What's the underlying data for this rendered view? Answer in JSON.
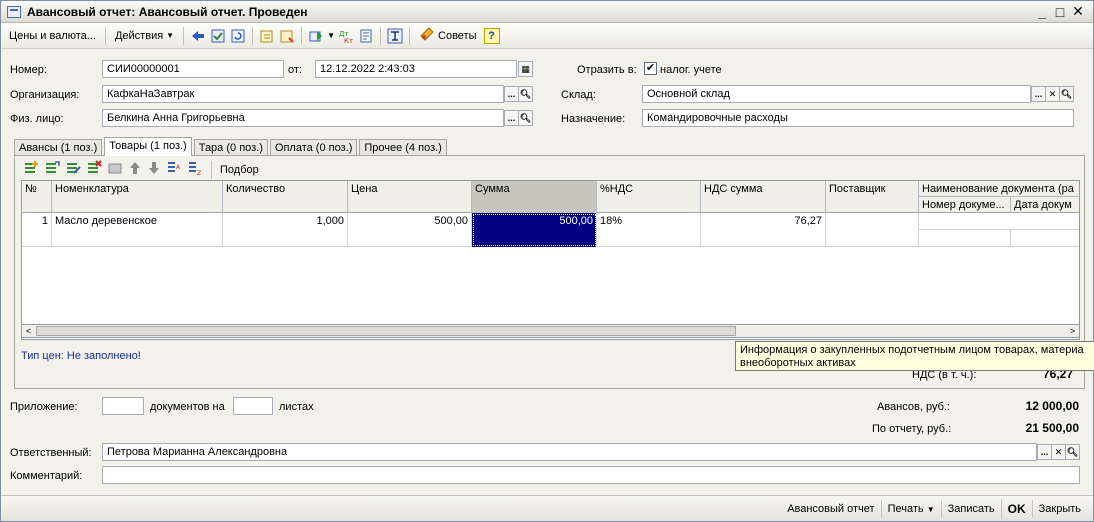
{
  "window": {
    "title": "Авансовый отчет: Авансовый отчет. Проведен",
    "min": "_",
    "max": "□",
    "close": "✕"
  },
  "toolbar": {
    "prices_currency": "Цены и валюта...",
    "actions": "Действия",
    "tips": "Советы",
    "help": "?"
  },
  "form": {
    "number_label": "Номер:",
    "number_value": "СИИ00000001",
    "from_label": "от:",
    "date_value": "12.12.2022  2:43:03",
    "reflect_label": "Отразить в:",
    "tax_accounting_label": "налог. учете",
    "tax_accounting_checked": "✔",
    "org_label": "Организация:",
    "org_value": "КафкаНаЗавтрак",
    "warehouse_label": "Склад:",
    "warehouse_value": "Основной склад",
    "person_label": "Физ. лицо:",
    "person_value": "Белкина Анна Григорьевна",
    "purpose_label": "Назначение:",
    "purpose_value": "Командировочные расходы"
  },
  "tabs": [
    {
      "label": "Авансы (1 поз.)"
    },
    {
      "label": "Товары (1 поз.)"
    },
    {
      "label": "Тара (0 поз.)"
    },
    {
      "label": "Оплата (0 поз.)"
    },
    {
      "label": "Прочее (4 поз.)"
    }
  ],
  "table_toolbar": {
    "selection": "Подбор"
  },
  "table": {
    "headers": {
      "num": "№",
      "nomenclature": "Номенклатура",
      "quantity": "Количество",
      "price": "Цена",
      "sum": "Сумма",
      "vat_rate": "%НДС",
      "vat_sum": "НДС сумма",
      "supplier": "Поставщик",
      "doc_name": "Наименование документа (ра",
      "doc_number": "Номер докуме...",
      "doc_date": "Дата докум"
    },
    "rows": [
      {
        "num": "1",
        "nomenclature": "Масло деревенское",
        "quantity": "1,000",
        "price": "500,00",
        "sum": "500,00",
        "vat_rate": "18%",
        "vat_sum": "76,27",
        "supplier": ""
      }
    ]
  },
  "price_type": "Тип цен: Не заполнено!",
  "tooltip": "Информация о закупленных подотчетным лицом товарах, материа внеоборотных активах",
  "totals": {
    "vat_label": "НДС (в т. ч.):",
    "vat_value": "76,27",
    "advances_label": "Авансов, руб.:",
    "advances_value": "12 000,00",
    "report_label": "По отчету, руб.:",
    "report_value": "21 500,00"
  },
  "attachment": {
    "label": "Приложение:",
    "docs_on": "документов на",
    "sheets": "листах"
  },
  "responsible": {
    "label": "Ответственный:",
    "value": "Петрова Марианна Александровна"
  },
  "comment": {
    "label": "Комментарий:",
    "value": ""
  },
  "bottom": {
    "advance_report": "Авансовый отчет",
    "print": "Печать",
    "save": "Записать",
    "ok": "OK",
    "close": "Закрыть"
  }
}
